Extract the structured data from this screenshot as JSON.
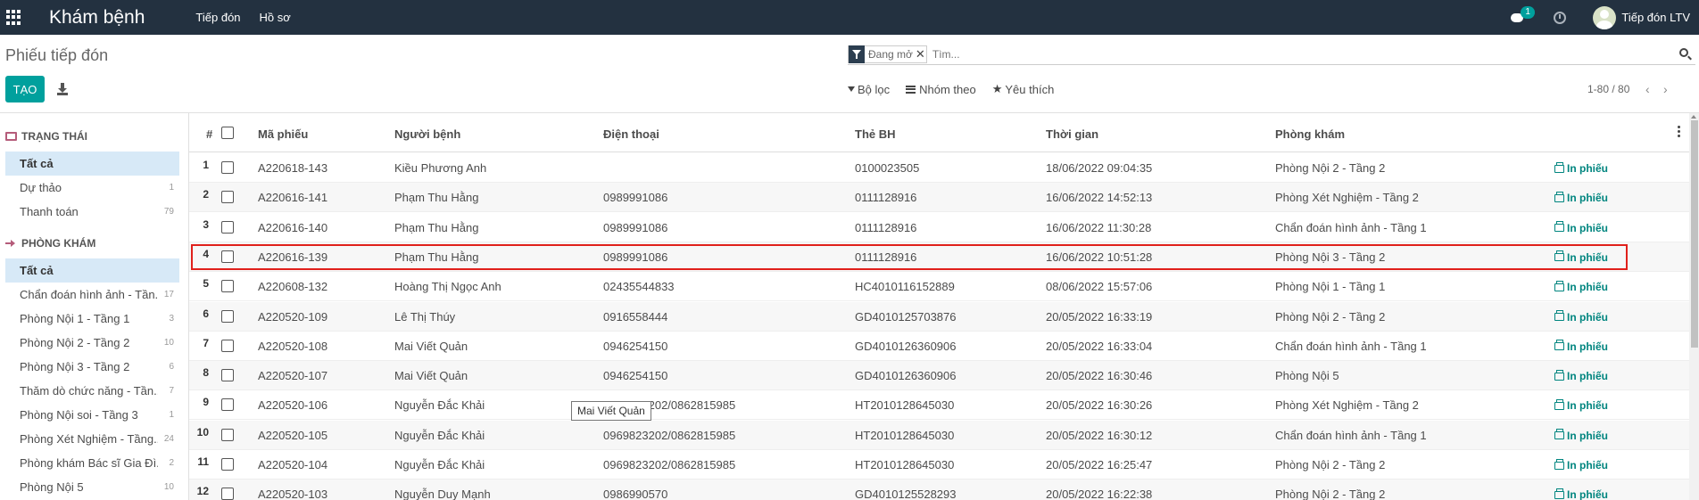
{
  "navbar": {
    "app_title": "Khám bệnh",
    "menu": [
      "Tiếp đón",
      "Hồ sơ"
    ],
    "chat_badge": "1",
    "user_name": "Tiếp đón LTV"
  },
  "control_panel": {
    "breadcrumb": "Phiếu tiếp đón",
    "create_label": "TẠO",
    "facet_label": "Đang mở",
    "search_placeholder": "Tìm...",
    "filter_label": "Bộ lọc",
    "groupby_label": "Nhóm theo",
    "favorites_label": "Yêu thích",
    "pager": "1-80 / 80"
  },
  "sidebar": {
    "status_title": "TRẠNG THÁI",
    "status_items": [
      {
        "label": "Tất cả",
        "count": ""
      },
      {
        "label": "Dự thảo",
        "count": "1"
      },
      {
        "label": "Thanh toán",
        "count": "79"
      }
    ],
    "clinic_title": "PHÒNG KHÁM",
    "clinic_items": [
      {
        "label": "Tất cả",
        "count": ""
      },
      {
        "label": "Chẩn đoán hình ảnh - Tần...",
        "count": "17"
      },
      {
        "label": "Phòng Nội 1 - Tầng 1",
        "count": "3"
      },
      {
        "label": "Phòng Nội 2 - Tầng 2",
        "count": "10"
      },
      {
        "label": "Phòng Nội 3 - Tầng 2",
        "count": "6"
      },
      {
        "label": "Thăm dò chức năng - Tần...",
        "count": "7"
      },
      {
        "label": "Phòng Nội soi - Tầng 3",
        "count": "1"
      },
      {
        "label": "Phòng Xét Nghiệm - Tầng...",
        "count": "24"
      },
      {
        "label": "Phòng khám Bác sĩ Gia Đì...",
        "count": "2"
      },
      {
        "label": "Phòng Nội 5",
        "count": "10"
      }
    ]
  },
  "table": {
    "columns": [
      "#",
      "Mã phiếu",
      "Người bệnh",
      "Điện thoại",
      "Thẻ BH",
      "Thời gian",
      "Phòng khám"
    ],
    "print_label": "In phiếu",
    "rows": [
      {
        "n": "1",
        "code": "A220618-143",
        "patient": "Kiều Phương Anh",
        "phone": "",
        "insurance": "0100023505",
        "time": "18/06/2022 09:04:35",
        "clinic": "Phòng Nội 2 - Tầng 2"
      },
      {
        "n": "2",
        "code": "A220616-141",
        "patient": "Phạm Thu Hằng",
        "phone": "0989991086",
        "insurance": "0111128916",
        "time": "16/06/2022 14:52:13",
        "clinic": "Phòng Xét Nghiệm - Tầng 2"
      },
      {
        "n": "3",
        "code": "A220616-140",
        "patient": "Phạm Thu Hằng",
        "phone": "0989991086",
        "insurance": "0111128916",
        "time": "16/06/2022 11:30:28",
        "clinic": "Chẩn đoán hình ảnh - Tầng 1"
      },
      {
        "n": "4",
        "code": "A220616-139",
        "patient": "Phạm Thu Hằng",
        "phone": "0989991086",
        "insurance": "0111128916",
        "time": "16/06/2022 10:51:28",
        "clinic": "Phòng Nội 3 - Tầng 2"
      },
      {
        "n": "5",
        "code": "A220608-132",
        "patient": "Hoàng Thị Ngọc Anh",
        "phone": "02435544833",
        "insurance": "HC4010116152889",
        "time": "08/06/2022 15:57:06",
        "clinic": "Phòng Nội 1 - Tầng 1"
      },
      {
        "n": "6",
        "code": "A220520-109",
        "patient": "Lê Thị Thúy",
        "phone": "0916558444",
        "insurance": "GD4010125703876",
        "time": "20/05/2022 16:33:19",
        "clinic": "Phòng Nội 2 - Tầng 2"
      },
      {
        "n": "7",
        "code": "A220520-108",
        "patient": "Mai Viết Quản",
        "phone": "0946254150",
        "insurance": "GD4010126360906",
        "time": "20/05/2022 16:33:04",
        "clinic": "Chẩn đoán hình ảnh - Tầng 1"
      },
      {
        "n": "8",
        "code": "A220520-107",
        "patient": "Mai Viết Quản",
        "phone": "0946254150",
        "insurance": "GD4010126360906",
        "time": "20/05/2022 16:30:46",
        "clinic": "Phòng Nội 5"
      },
      {
        "n": "9",
        "code": "A220520-106",
        "patient": "Nguyễn Đắc Khải",
        "phone": "0969823202/0862815985",
        "insurance": "HT2010128645030",
        "time": "20/05/2022 16:30:26",
        "clinic": "Phòng Xét Nghiệm - Tầng 2"
      },
      {
        "n": "10",
        "code": "A220520-105",
        "patient": "Nguyễn Đắc Khải",
        "phone": "0969823202/0862815985",
        "insurance": "HT2010128645030",
        "time": "20/05/2022 16:30:12",
        "clinic": "Chẩn đoán hình ảnh - Tầng 1"
      },
      {
        "n": "11",
        "code": "A220520-104",
        "patient": "Nguyễn Đắc Khải",
        "phone": "0969823202/0862815985",
        "insurance": "HT2010128645030",
        "time": "20/05/2022 16:25:47",
        "clinic": "Phòng Nội 2 - Tầng 2"
      },
      {
        "n": "12",
        "code": "A220520-103",
        "patient": "Nguyễn Duy Mạnh",
        "phone": "0986990570",
        "insurance": "GD4010125528293",
        "time": "20/05/2022 16:22:38",
        "clinic": "Phòng Nội 2 - Tầng 2"
      }
    ]
  },
  "tooltip": "Mai Viết Quản"
}
